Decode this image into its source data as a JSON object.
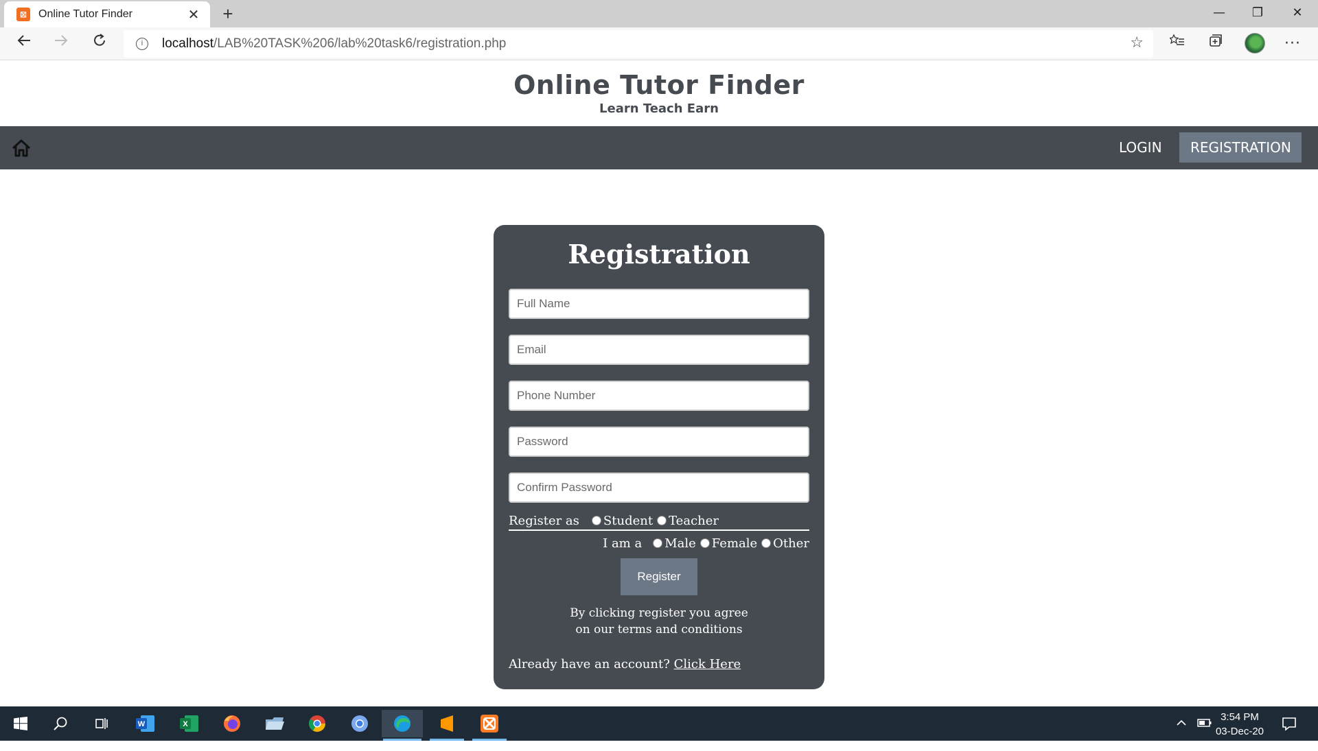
{
  "browser": {
    "tab_title": "Online Tutor Finder",
    "tab_favicon_glyph": "⊠",
    "url_host": "localhost",
    "url_path": "/LAB%20TASK%206/lab%20task6/registration.php"
  },
  "site": {
    "title": "Online Tutor Finder",
    "tagline": "Learn Teach Earn"
  },
  "nav": {
    "login_label": "LOGIN",
    "registration_label": "REGISTRATION"
  },
  "form": {
    "heading": "Registration",
    "fullname_placeholder": "Full Name",
    "email_placeholder": "Email",
    "phone_placeholder": "Phone Number",
    "password_placeholder": "Password",
    "confirm_placeholder": "Confirm Password",
    "register_as_label": "Register as",
    "role_options": [
      "Student",
      "Teacher"
    ],
    "gender_label": "I am a",
    "gender_options": [
      "Male",
      "Female",
      "Other"
    ],
    "submit_label": "Register",
    "terms_line1": "By clicking register you agree",
    "terms_line2": "on our terms and conditions",
    "account_prompt": "Already have an account?",
    "account_link": "Click Here"
  },
  "taskbar": {
    "time": "3:54 PM",
    "date": "03-Dec-20"
  },
  "colors": {
    "panel": "#464b52",
    "active_nav": "#6d7887",
    "button": "#6d7887",
    "taskbar": "#1e2a36"
  }
}
